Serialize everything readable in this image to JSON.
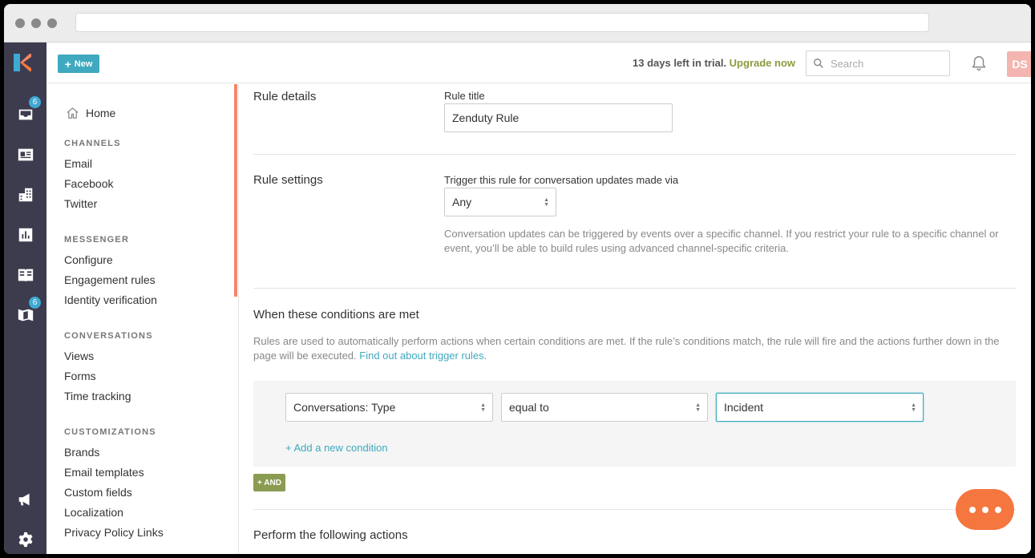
{
  "colors": {
    "accent": "#3fa9bf",
    "rail": "#3c3c4e",
    "upgrade": "#8a9b3f",
    "chat": "#f5763f",
    "badge": "#3fa9d4"
  },
  "rail": {
    "items": [
      {
        "icon": "inbox-icon",
        "badge": "6"
      },
      {
        "icon": "contacts-icon",
        "badge": ""
      },
      {
        "icon": "organizations-icon",
        "badge": ""
      },
      {
        "icon": "reports-icon",
        "badge": ""
      },
      {
        "icon": "knowledge-base-icon",
        "badge": ""
      },
      {
        "icon": "roadmap-icon",
        "badge": "6"
      },
      {
        "icon": "announcements-icon",
        "badge": ""
      },
      {
        "icon": "settings-icon",
        "badge": ""
      }
    ]
  },
  "topbar": {
    "new_label": "New",
    "trial_text": "13 days left in trial.",
    "upgrade_label": "Upgrade now",
    "search_placeholder": "Search",
    "avatar_initials": "DS"
  },
  "sidebar": {
    "home": "Home",
    "sections": [
      {
        "title": "CHANNELS",
        "items": [
          "Email",
          "Facebook",
          "Twitter"
        ]
      },
      {
        "title": "MESSENGER",
        "items": [
          "Configure",
          "Engagement rules",
          "Identity verification"
        ]
      },
      {
        "title": "CONVERSATIONS",
        "items": [
          "Views",
          "Forms",
          "Time tracking"
        ]
      },
      {
        "title": "CUSTOMIZATIONS",
        "items": [
          "Brands",
          "Email templates",
          "Custom fields",
          "Localization",
          "Privacy Policy Links"
        ]
      }
    ]
  },
  "main": {
    "rule_details": {
      "section_title": "Rule details",
      "title_label": "Rule title",
      "title_value": "Zenduty Rule"
    },
    "rule_settings": {
      "section_title": "Rule settings",
      "trigger_label": "Trigger this rule for conversation updates made via",
      "trigger_value": "Any",
      "help_text": "Conversation updates can be triggered by events over a specific channel. If you restrict your rule to a specific channel or event, you’ll be able to build rules using advanced channel-specific criteria."
    },
    "conditions": {
      "section_title": "When these conditions are met",
      "description": "Rules are used to automatically perform actions when certain conditions are met. If the rule’s conditions match, the rule will fire and the actions further down in the page will be executed.",
      "link_text": "Find out about trigger rules.",
      "field_value": "Conversations: Type",
      "operator_value": "equal to",
      "value_value": "Incident",
      "add_condition_label": "+ Add a new condition",
      "and_label": "+ AND"
    },
    "actions": {
      "section_title": "Perform the following actions"
    }
  }
}
